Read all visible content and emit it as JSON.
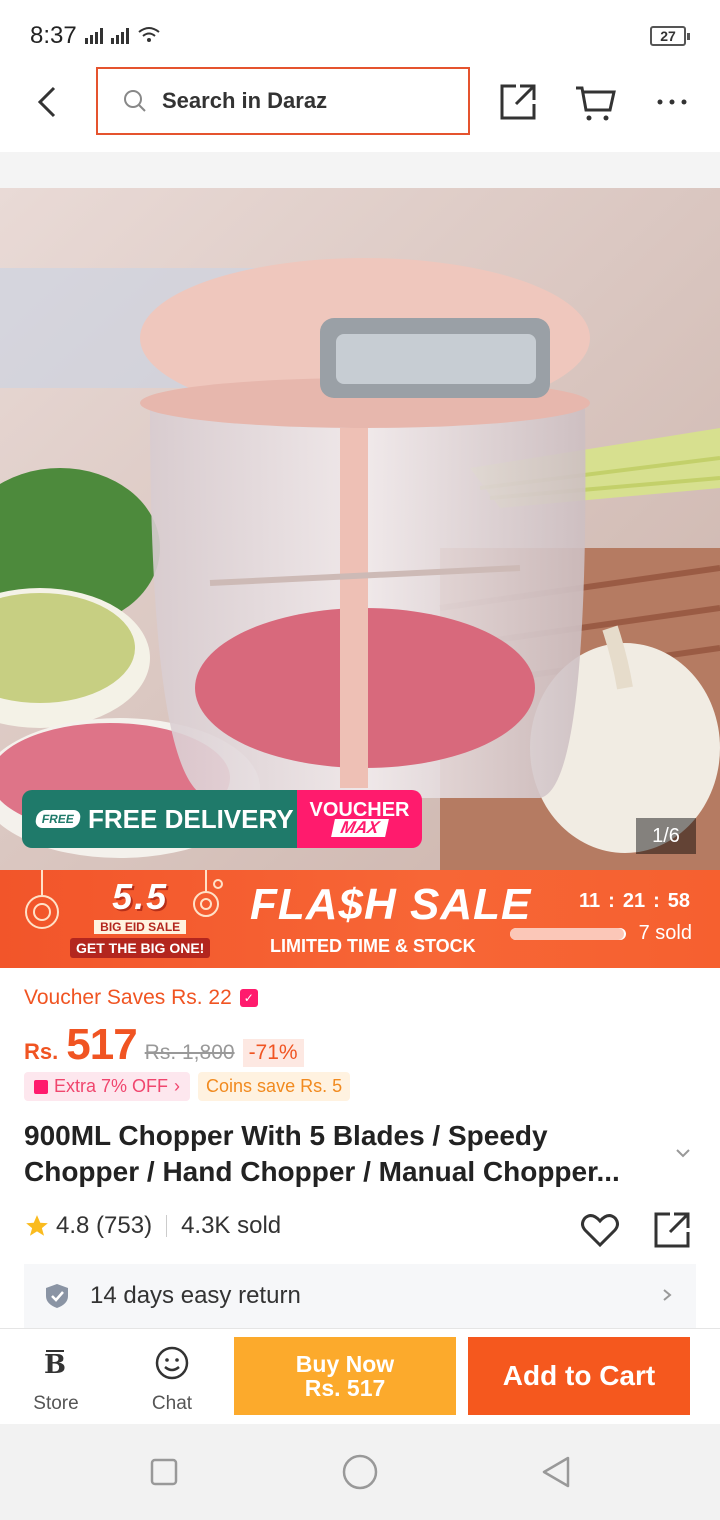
{
  "status": {
    "time": "8:37",
    "battery": "27"
  },
  "header": {
    "search_placeholder": "Search in Daraz"
  },
  "gallery": {
    "counter": "1/6",
    "free_tag": "FREE",
    "free_delivery": "FREE DELIVERY",
    "voucher_line1": "VOUCHER",
    "voucher_line2": "MAX"
  },
  "flash": {
    "campaign_number": "5.5",
    "campaign_line1": "BIG EID SALE",
    "campaign_line2": "GET THE BIG ONE!",
    "title": "FLA$H SALE",
    "subtitle": "LIMITED TIME & STOCK",
    "timer_h": "11",
    "timer_m": "21",
    "timer_s": "58",
    "sold": "7 sold",
    "sold_progress": 0.98
  },
  "product": {
    "voucher_saves": "Voucher Saves Rs. 22",
    "currency": "Rs.",
    "price": "517",
    "original_price": "Rs. 1,800",
    "discount": "-71%",
    "extra_off": "Extra 7% OFF",
    "coins": "Coins save Rs. 5",
    "title": "900ML Chopper With 5 Blades / Speedy Chopper / Hand Chopper / Manual Chopper...",
    "rating": "4.8 (753)",
    "sold": "4.3K sold",
    "return_policy": "14 days easy return"
  },
  "actions": {
    "store": "Store",
    "chat": "Chat",
    "buy_now_line1": "Buy Now",
    "buy_now_line2": "Rs. 517",
    "add_to_cart": "Add to Cart"
  },
  "colors": {
    "accent": "#f5581e",
    "buy_now": "#fcaa2c",
    "delivery": "#1f7a6a",
    "voucher": "#ff1b6d"
  }
}
